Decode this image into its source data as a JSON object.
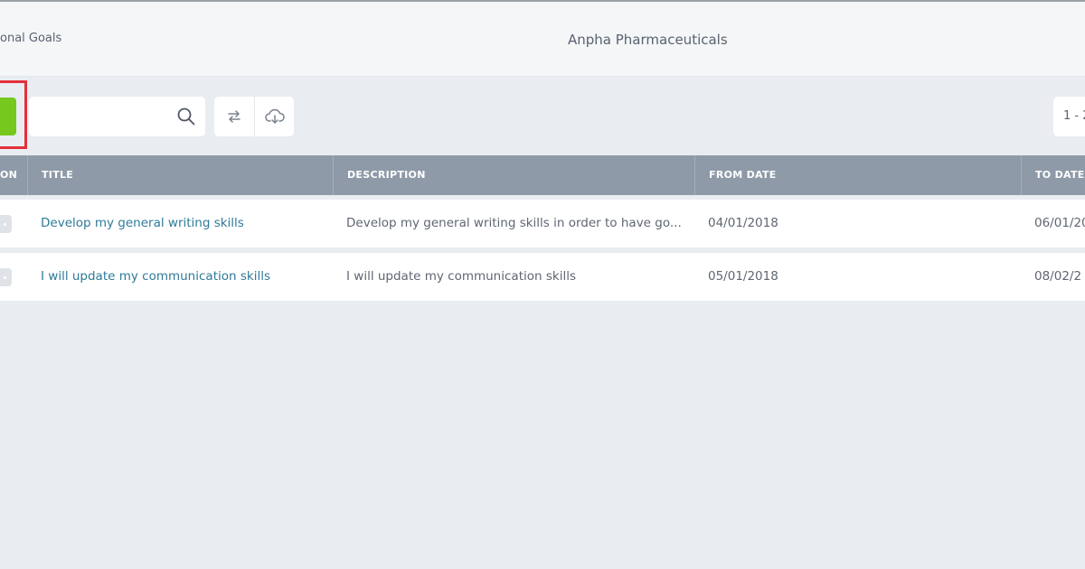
{
  "header": {
    "page_title": "onal Goals",
    "company": "Anpha Pharmaceuticals"
  },
  "toolbar": {
    "search_placeholder": "",
    "pagination": "1 - 2"
  },
  "table": {
    "columns": [
      "ON",
      "TITLE",
      "DESCRIPTION",
      "FROM DATE",
      "TO DATE"
    ],
    "rows": [
      {
        "title": "Develop my general writing skills",
        "description": "Develop my general writing skills in order to have go...",
        "from_date": "04/01/2018",
        "to_date": "06/01/20"
      },
      {
        "title": "I will update my communication skills",
        "description": "I will update my communication skills",
        "from_date": "05/01/2018",
        "to_date": "08/02/2"
      }
    ]
  },
  "colors": {
    "accent_green": "#76c81f",
    "highlight_red": "#e2303c",
    "table_header": "#8e9aa8",
    "link": "#2f7a98"
  }
}
